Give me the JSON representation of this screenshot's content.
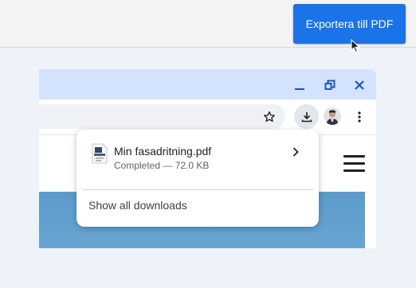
{
  "app": {
    "export_button_label": "Exportera till PDF"
  },
  "browser": {
    "titlebar_color": "#d3e3fd",
    "window_controls": [
      "minimize-icon",
      "restore-icon",
      "close-icon"
    ],
    "toolbar_icons": [
      "star-icon",
      "download-icon",
      "avatar",
      "more-vert-icon"
    ]
  },
  "download_popup": {
    "file_name": "Min fasadritning.pdf",
    "file_status": "Completed — 72.0 KB",
    "show_all_label": "Show all downloads"
  },
  "colors": {
    "accent": "#1a73e8",
    "icon_blue": "#1a56c4",
    "hero": "#5b9bcb"
  }
}
